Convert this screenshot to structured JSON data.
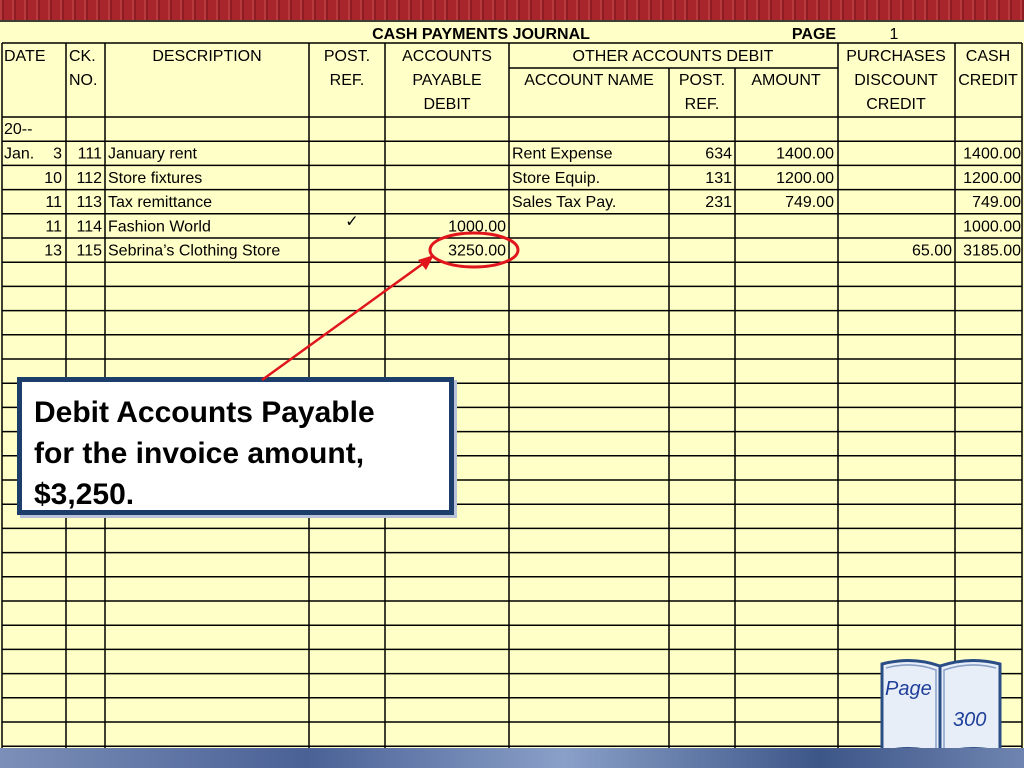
{
  "journal": {
    "title": "CASH PAYMENTS JOURNAL",
    "page_label": "PAGE",
    "page_number": "1",
    "headers": {
      "date": "DATE",
      "ck_no": [
        "CK.",
        "NO."
      ],
      "description": "DESCRIPTION",
      "post_ref": [
        "POST.",
        "REF."
      ],
      "accounts_payable_debit": [
        "ACCOUNTS",
        "PAYABLE",
        "DEBIT"
      ],
      "other_accounts_debit": "OTHER ACCOUNTS DEBIT",
      "account_name": "ACCOUNT NAME",
      "other_post_ref": [
        "POST.",
        "REF."
      ],
      "amount": "AMOUNT",
      "purchases_discount_credit": [
        "PURCHASES",
        "DISCOUNT",
        "CREDIT"
      ],
      "cash_credit": [
        "CASH",
        "CREDIT"
      ]
    },
    "year_row": "20--",
    "rows": [
      {
        "month": "Jan.",
        "day": "3",
        "ck": "111",
        "description": "January rent",
        "post_ref": "",
        "ap_debit": "",
        "account_name": "Rent Expense",
        "acct_post_ref": "634",
        "amount": "1400.00",
        "purch_disc": "",
        "cash_credit": "1400.00"
      },
      {
        "month": "",
        "day": "10",
        "ck": "112",
        "description": "Store fixtures",
        "post_ref": "",
        "ap_debit": "",
        "account_name": "Store Equip.",
        "acct_post_ref": "131",
        "amount": "1200.00",
        "purch_disc": "",
        "cash_credit": "1200.00"
      },
      {
        "month": "",
        "day": "11",
        "ck": "113",
        "description": "Tax remittance",
        "post_ref": "",
        "ap_debit": "",
        "account_name": "Sales Tax Pay.",
        "acct_post_ref": "231",
        "amount": "749.00",
        "purch_disc": "",
        "cash_credit": "749.00"
      },
      {
        "month": "",
        "day": "11",
        "ck": "114",
        "description": "Fashion World",
        "post_ref": "✓",
        "ap_debit": "1000.00",
        "account_name": "",
        "acct_post_ref": "",
        "amount": "",
        "purch_disc": "",
        "cash_credit": "1000.00"
      },
      {
        "month": "",
        "day": "13",
        "ck": "115",
        "description": "Sebrina’s Clothing Store",
        "post_ref": "",
        "ap_debit": "3250.00",
        "account_name": "",
        "acct_post_ref": "",
        "amount": "",
        "purch_disc": "65.00",
        "cash_credit": "3185.00"
      }
    ]
  },
  "callout": {
    "text": "Debit Accounts Payable\nfor the invoice amount,\n$3,250."
  },
  "page_reference": {
    "label": "Page",
    "number": "300"
  },
  "colors": {
    "paper": "#ffffc8",
    "highlight_circle": "#e0161c",
    "callout_border": "#1d3d6b",
    "page_text": "#1f3f9a"
  }
}
